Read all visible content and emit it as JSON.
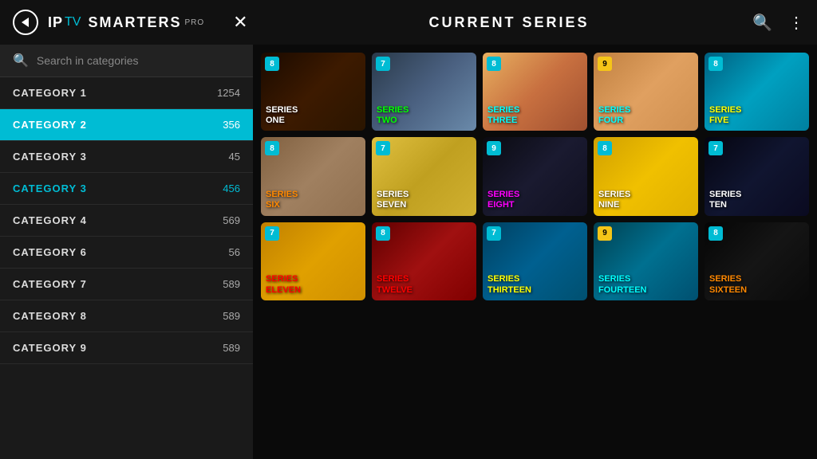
{
  "header": {
    "back_label": "←",
    "logo_ip": "IP",
    "logo_tv": "TV",
    "logo_smarters": "SMARTERS",
    "logo_pro": "PRO",
    "close_label": "✕",
    "title": "CURRENT SERIES",
    "search_icon": "🔍",
    "more_icon": "⋮"
  },
  "sidebar": {
    "search_placeholder": "Search in categories",
    "categories": [
      {
        "name": "CATEGORY  1",
        "count": "1254",
        "state": "normal"
      },
      {
        "name": "CATEGORY  2",
        "count": "356",
        "state": "active-teal"
      },
      {
        "name": "CATEGORY  3",
        "count": "45",
        "state": "normal"
      },
      {
        "name": "CATEGORY 3",
        "count": "456",
        "state": "active-highlight"
      },
      {
        "name": "CATEGORY  4",
        "count": "569",
        "state": "normal"
      },
      {
        "name": "CATEGORY  6",
        "count": "56",
        "state": "normal"
      },
      {
        "name": "CATEGORY  7",
        "count": "589",
        "state": "normal"
      },
      {
        "name": "CATEGORY  8",
        "count": "589",
        "state": "normal"
      },
      {
        "name": "CATEGORY  9",
        "count": "589",
        "state": "normal"
      }
    ]
  },
  "grid": {
    "rows": [
      [
        {
          "badge": "8",
          "badge_style": "blue",
          "title_line1": "SERIES",
          "title_line2": "ONE",
          "title_color": "#fff",
          "bg": "bg-dark1"
        },
        {
          "badge": "7",
          "badge_style": "blue",
          "title_line1": "SERIES",
          "title_line2": "TWO",
          "title_color": "#00ff00",
          "bg": "bg-city"
        },
        {
          "badge": "8",
          "badge_style": "blue",
          "title_line1": "SERIES",
          "title_line2": "THREE",
          "title_color": "#00ffff",
          "bg": "bg-colorful"
        },
        {
          "badge": "9",
          "badge_style": "yellow",
          "title_line1": "SERIES",
          "title_line2": "FOUR",
          "title_color": "#00ffff",
          "bg": "bg-desert"
        },
        {
          "badge": "8",
          "badge_style": "blue",
          "title_line1": "SERIES",
          "title_line2": "FIVE",
          "title_color": "#ffff00",
          "bg": "bg-teal"
        }
      ],
      [
        {
          "badge": "8",
          "badge_style": "blue",
          "title_line1": "SERIES",
          "title_line2": "SIX",
          "title_color": "#ff8800",
          "bg": "bg-street"
        },
        {
          "badge": "7",
          "badge_style": "blue",
          "title_line1": "SERIES",
          "title_line2": "SEVEN",
          "title_color": "#fff",
          "bg": "bg-yellow"
        },
        {
          "badge": "9",
          "badge_style": "blue",
          "title_line1": "SERIES",
          "title_line2": "EIGHT",
          "title_color": "#ff00ff",
          "bg": "bg-dark2"
        },
        {
          "badge": "8",
          "badge_style": "blue",
          "title_line1": "SERIES",
          "title_line2": "NINE",
          "title_color": "#fff",
          "bg": "bg-yellow2"
        },
        {
          "badge": "7",
          "badge_style": "blue",
          "title_line1": "SERIES",
          "title_line2": "TEN",
          "title_color": "#fff",
          "bg": "bg-night"
        }
      ],
      [
        {
          "badge": "7",
          "badge_style": "blue",
          "title_line1": "SERIES",
          "title_line2": "ELEVEN",
          "title_color": "#ff0000",
          "bg": "bg-golden"
        },
        {
          "badge": "8",
          "badge_style": "blue",
          "title_line1": "SERIES",
          "title_line2": "TWELVE",
          "title_color": "#ff0000",
          "bg": "bg-red"
        },
        {
          "badge": "7",
          "badge_style": "blue",
          "title_line1": "SERIES",
          "title_line2": "THIRTEEN",
          "title_color": "#ffff00",
          "bg": "bg-blue2"
        },
        {
          "badge": "9",
          "badge_style": "yellow",
          "title_line1": "SERIES",
          "title_line2": "FOURTEEN",
          "title_color": "#00ffff",
          "bg": "bg-teal2"
        },
        {
          "badge": "8",
          "badge_style": "blue",
          "title_line1": "SERIES",
          "title_line2": "SIXTEEN",
          "title_color": "#ff8800",
          "bg": "bg-dark3"
        }
      ]
    ]
  }
}
